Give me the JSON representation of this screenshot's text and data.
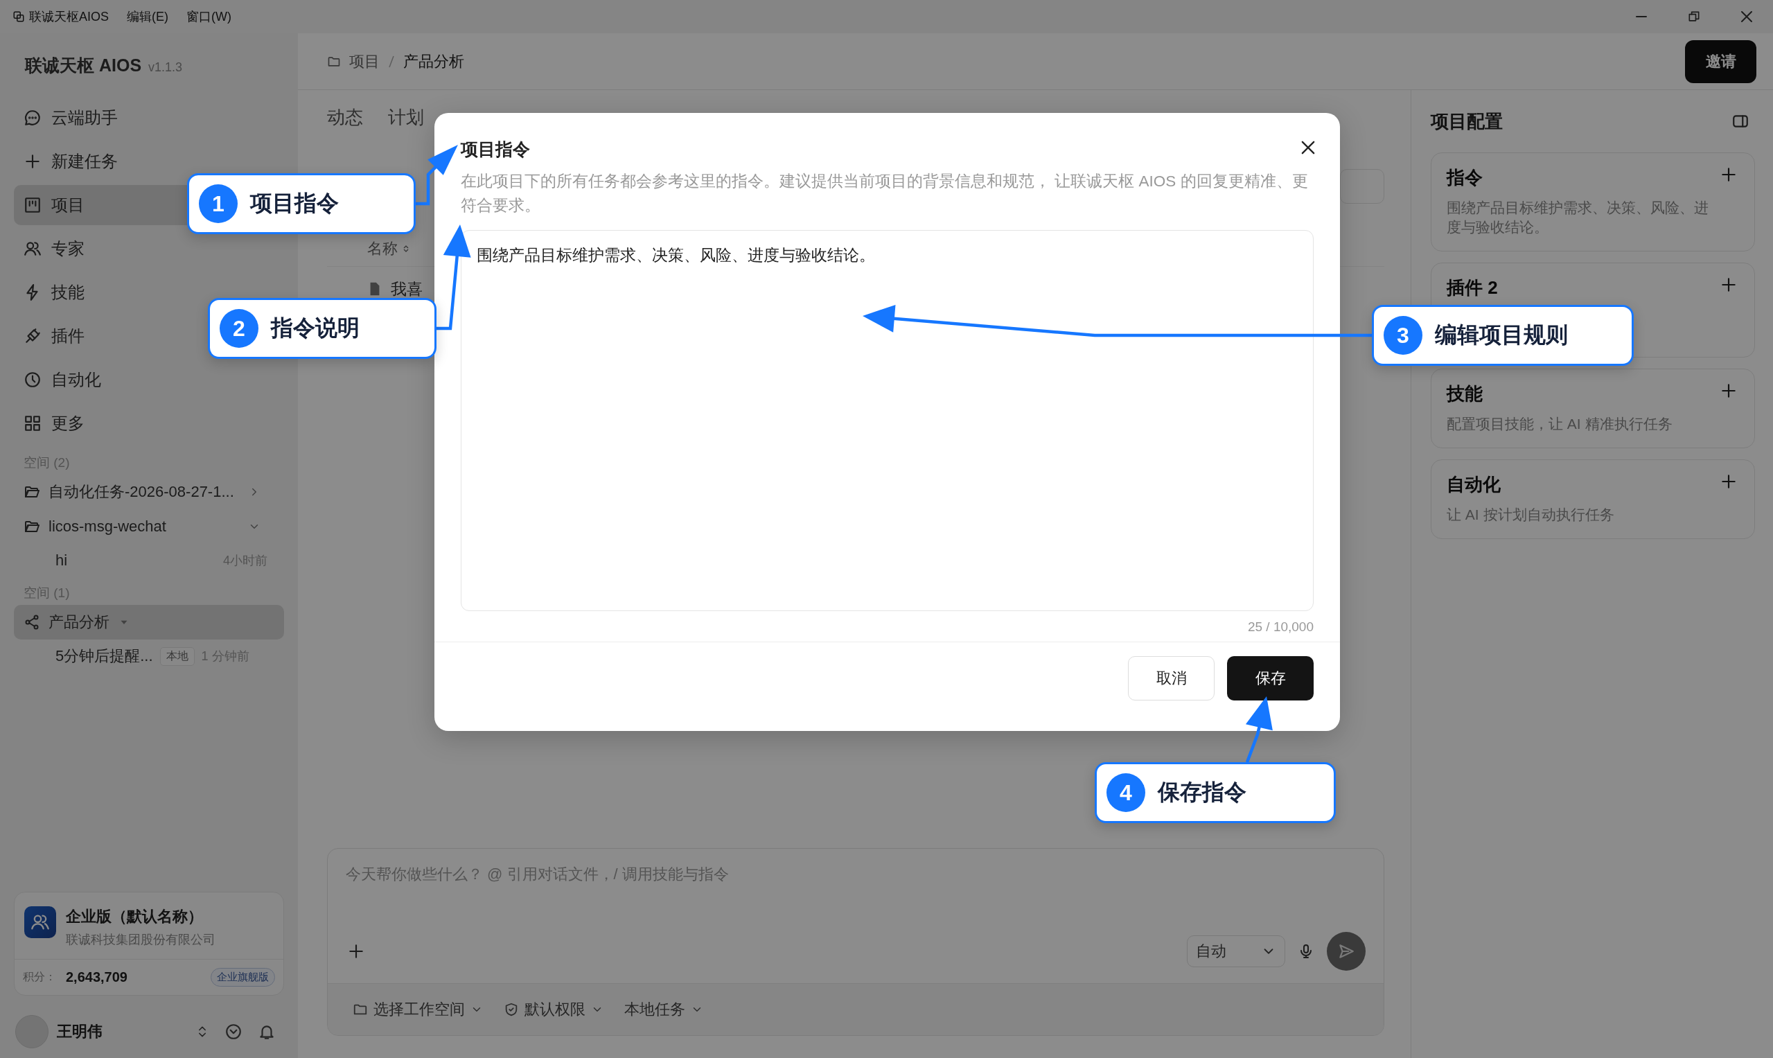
{
  "title_bar": {
    "app_name": "联诚天枢AIOS",
    "menus": [
      "编辑(E)",
      "窗口(W)"
    ]
  },
  "sidebar": {
    "brand": "联诚天枢 AIOS",
    "version": "v1.1.3",
    "nav": [
      {
        "label": "云端助手",
        "selected": false
      },
      {
        "label": "新建任务",
        "selected": false
      },
      {
        "label": "项目",
        "selected": true
      },
      {
        "label": "专家",
        "selected": false
      },
      {
        "label": "技能",
        "selected": false
      },
      {
        "label": "插件",
        "selected": false
      },
      {
        "label": "自动化",
        "selected": false
      },
      {
        "label": "更多",
        "selected": false
      }
    ],
    "sections": [
      {
        "heading": "空间 (2)",
        "items": [
          {
            "label": "自动化任务-2026-08-27-1...",
            "selected": false,
            "expanded": false
          },
          {
            "label": "licos-msg-wechat",
            "selected": false,
            "expanded": true,
            "children": [
              {
                "label": "hi",
                "time": "4小时前"
              }
            ]
          }
        ]
      },
      {
        "heading": "空间 (1)",
        "items": [
          {
            "label": "产品分析",
            "selected": true,
            "expanded": true,
            "children": [
              {
                "label": "5分钟后提醒...",
                "tag": "本地",
                "time": "1 分钟前"
              }
            ]
          }
        ]
      }
    ],
    "enterprise": {
      "name": "企业版（默认名称）",
      "company": "联诚科技集团股份有限公司",
      "points_label": "积分：",
      "points": "2,643,709",
      "badge": "企业旗舰版"
    },
    "user": {
      "name": "王明伟"
    }
  },
  "main": {
    "breadcrumb": [
      "项目",
      "产品分析"
    ],
    "invite_button": "邀请",
    "tabs": [
      {
        "label": "动态",
        "selected": false
      },
      {
        "label": "计划",
        "selected": false
      }
    ],
    "table": {
      "columns": [
        "名称"
      ],
      "rows": [
        [
          "我喜"
        ]
      ]
    },
    "composer": {
      "placeholder": "今天帮你做些什么？ @ 引用对话文件，/ 调用技能与指令",
      "mode": "自动",
      "chips": [
        "选择工作空间",
        "默认权限",
        "本地任务"
      ]
    }
  },
  "right_panel": {
    "title": "项目配置",
    "cards": [
      {
        "title": "指令",
        "description": "围绕产品目标维护需求、决策、风险、进度与验收结论。"
      },
      {
        "title": "插件 2"
      },
      {
        "title": "技能",
        "description": "配置项目技能，让 AI 精准执行任务"
      },
      {
        "title": "自动化",
        "description": "让 AI 按计划自动执行任务"
      }
    ]
  },
  "dialog": {
    "title": "项目指令",
    "description": "在此项目下的所有任务都会参考这里的指令。建议提供当前项目的背景信息和规范， 让联诚天枢 AIOS 的回复更精准、更符合要求。",
    "value": "围绕产品目标维护需求、决策、风险、进度与验收结论。",
    "counter": "25 / 10,000",
    "buttons": [
      {
        "label": "取消",
        "kind": "secondary"
      },
      {
        "label": "保存",
        "kind": "primary"
      }
    ]
  },
  "callouts": [
    {
      "number": "1",
      "label": "项目指令"
    },
    {
      "number": "2",
      "label": "指令说明"
    },
    {
      "number": "3",
      "label": "编辑项目规则"
    },
    {
      "number": "4",
      "label": "保存指令"
    }
  ]
}
